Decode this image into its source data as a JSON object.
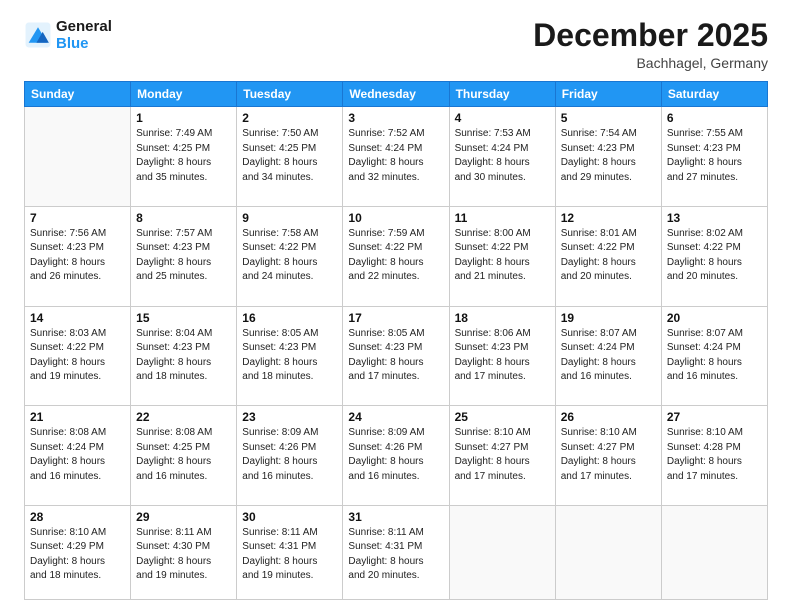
{
  "logo": {
    "line1": "General",
    "line2": "Blue"
  },
  "title": "December 2025",
  "location": "Bachhagel, Germany",
  "days_header": [
    "Sunday",
    "Monday",
    "Tuesday",
    "Wednesday",
    "Thursday",
    "Friday",
    "Saturday"
  ],
  "weeks": [
    [
      {
        "day": "",
        "sunrise": "",
        "sunset": "",
        "daylight": ""
      },
      {
        "day": "1",
        "sunrise": "Sunrise: 7:49 AM",
        "sunset": "Sunset: 4:25 PM",
        "daylight": "Daylight: 8 hours and 35 minutes."
      },
      {
        "day": "2",
        "sunrise": "Sunrise: 7:50 AM",
        "sunset": "Sunset: 4:25 PM",
        "daylight": "Daylight: 8 hours and 34 minutes."
      },
      {
        "day": "3",
        "sunrise": "Sunrise: 7:52 AM",
        "sunset": "Sunset: 4:24 PM",
        "daylight": "Daylight: 8 hours and 32 minutes."
      },
      {
        "day": "4",
        "sunrise": "Sunrise: 7:53 AM",
        "sunset": "Sunset: 4:24 PM",
        "daylight": "Daylight: 8 hours and 30 minutes."
      },
      {
        "day": "5",
        "sunrise": "Sunrise: 7:54 AM",
        "sunset": "Sunset: 4:23 PM",
        "daylight": "Daylight: 8 hours and 29 minutes."
      },
      {
        "day": "6",
        "sunrise": "Sunrise: 7:55 AM",
        "sunset": "Sunset: 4:23 PM",
        "daylight": "Daylight: 8 hours and 27 minutes."
      }
    ],
    [
      {
        "day": "7",
        "sunrise": "Sunrise: 7:56 AM",
        "sunset": "Sunset: 4:23 PM",
        "daylight": "Daylight: 8 hours and 26 minutes."
      },
      {
        "day": "8",
        "sunrise": "Sunrise: 7:57 AM",
        "sunset": "Sunset: 4:23 PM",
        "daylight": "Daylight: 8 hours and 25 minutes."
      },
      {
        "day": "9",
        "sunrise": "Sunrise: 7:58 AM",
        "sunset": "Sunset: 4:22 PM",
        "daylight": "Daylight: 8 hours and 24 minutes."
      },
      {
        "day": "10",
        "sunrise": "Sunrise: 7:59 AM",
        "sunset": "Sunset: 4:22 PM",
        "daylight": "Daylight: 8 hours and 22 minutes."
      },
      {
        "day": "11",
        "sunrise": "Sunrise: 8:00 AM",
        "sunset": "Sunset: 4:22 PM",
        "daylight": "Daylight: 8 hours and 21 minutes."
      },
      {
        "day": "12",
        "sunrise": "Sunrise: 8:01 AM",
        "sunset": "Sunset: 4:22 PM",
        "daylight": "Daylight: 8 hours and 20 minutes."
      },
      {
        "day": "13",
        "sunrise": "Sunrise: 8:02 AM",
        "sunset": "Sunset: 4:22 PM",
        "daylight": "Daylight: 8 hours and 20 minutes."
      }
    ],
    [
      {
        "day": "14",
        "sunrise": "Sunrise: 8:03 AM",
        "sunset": "Sunset: 4:22 PM",
        "daylight": "Daylight: 8 hours and 19 minutes."
      },
      {
        "day": "15",
        "sunrise": "Sunrise: 8:04 AM",
        "sunset": "Sunset: 4:23 PM",
        "daylight": "Daylight: 8 hours and 18 minutes."
      },
      {
        "day": "16",
        "sunrise": "Sunrise: 8:05 AM",
        "sunset": "Sunset: 4:23 PM",
        "daylight": "Daylight: 8 hours and 18 minutes."
      },
      {
        "day": "17",
        "sunrise": "Sunrise: 8:05 AM",
        "sunset": "Sunset: 4:23 PM",
        "daylight": "Daylight: 8 hours and 17 minutes."
      },
      {
        "day": "18",
        "sunrise": "Sunrise: 8:06 AM",
        "sunset": "Sunset: 4:23 PM",
        "daylight": "Daylight: 8 hours and 17 minutes."
      },
      {
        "day": "19",
        "sunrise": "Sunrise: 8:07 AM",
        "sunset": "Sunset: 4:24 PM",
        "daylight": "Daylight: 8 hours and 16 minutes."
      },
      {
        "day": "20",
        "sunrise": "Sunrise: 8:07 AM",
        "sunset": "Sunset: 4:24 PM",
        "daylight": "Daylight: 8 hours and 16 minutes."
      }
    ],
    [
      {
        "day": "21",
        "sunrise": "Sunrise: 8:08 AM",
        "sunset": "Sunset: 4:24 PM",
        "daylight": "Daylight: 8 hours and 16 minutes."
      },
      {
        "day": "22",
        "sunrise": "Sunrise: 8:08 AM",
        "sunset": "Sunset: 4:25 PM",
        "daylight": "Daylight: 8 hours and 16 minutes."
      },
      {
        "day": "23",
        "sunrise": "Sunrise: 8:09 AM",
        "sunset": "Sunset: 4:26 PM",
        "daylight": "Daylight: 8 hours and 16 minutes."
      },
      {
        "day": "24",
        "sunrise": "Sunrise: 8:09 AM",
        "sunset": "Sunset: 4:26 PM",
        "daylight": "Daylight: 8 hours and 16 minutes."
      },
      {
        "day": "25",
        "sunrise": "Sunrise: 8:10 AM",
        "sunset": "Sunset: 4:27 PM",
        "daylight": "Daylight: 8 hours and 17 minutes."
      },
      {
        "day": "26",
        "sunrise": "Sunrise: 8:10 AM",
        "sunset": "Sunset: 4:27 PM",
        "daylight": "Daylight: 8 hours and 17 minutes."
      },
      {
        "day": "27",
        "sunrise": "Sunrise: 8:10 AM",
        "sunset": "Sunset: 4:28 PM",
        "daylight": "Daylight: 8 hours and 17 minutes."
      }
    ],
    [
      {
        "day": "28",
        "sunrise": "Sunrise: 8:10 AM",
        "sunset": "Sunset: 4:29 PM",
        "daylight": "Daylight: 8 hours and 18 minutes."
      },
      {
        "day": "29",
        "sunrise": "Sunrise: 8:11 AM",
        "sunset": "Sunset: 4:30 PM",
        "daylight": "Daylight: 8 hours and 19 minutes."
      },
      {
        "day": "30",
        "sunrise": "Sunrise: 8:11 AM",
        "sunset": "Sunset: 4:31 PM",
        "daylight": "Daylight: 8 hours and 19 minutes."
      },
      {
        "day": "31",
        "sunrise": "Sunrise: 8:11 AM",
        "sunset": "Sunset: 4:31 PM",
        "daylight": "Daylight: 8 hours and 20 minutes."
      },
      {
        "day": "",
        "sunrise": "",
        "sunset": "",
        "daylight": ""
      },
      {
        "day": "",
        "sunrise": "",
        "sunset": "",
        "daylight": ""
      },
      {
        "day": "",
        "sunrise": "",
        "sunset": "",
        "daylight": ""
      }
    ]
  ]
}
